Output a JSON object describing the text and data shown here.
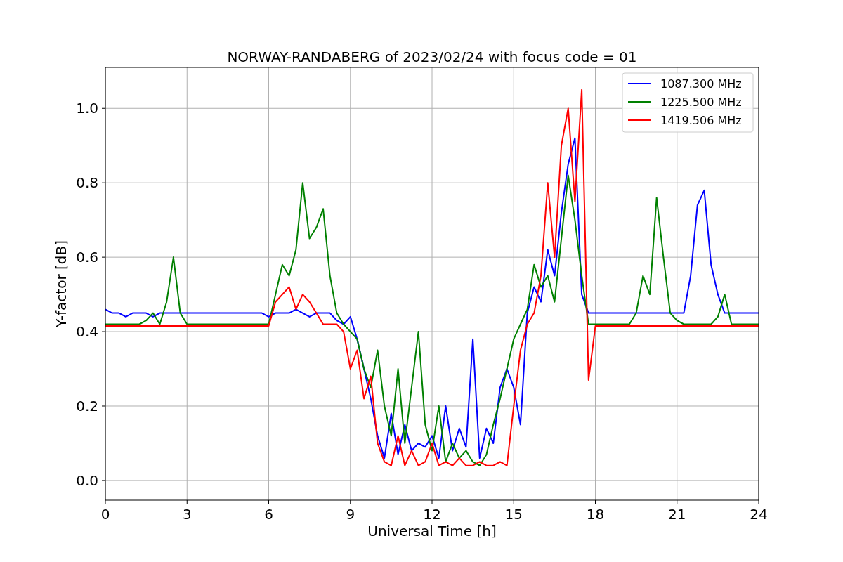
{
  "chart_data": {
    "type": "line",
    "title": "NORWAY-RANDABERG of 2023/02/24 with focus code = 01",
    "xlabel": "Universal Time [h]",
    "ylabel": "Y-factor [dB]",
    "x": [
      0,
      0.25,
      0.5,
      0.75,
      1,
      1.25,
      1.5,
      1.75,
      2,
      2.25,
      2.5,
      2.75,
      3,
      3.25,
      3.5,
      3.75,
      4,
      4.25,
      4.5,
      4.75,
      5,
      5.25,
      5.5,
      5.75,
      6,
      6.25,
      6.5,
      6.75,
      7,
      7.25,
      7.5,
      7.75,
      8,
      8.25,
      8.5,
      8.75,
      9,
      9.25,
      9.5,
      9.75,
      10,
      10.25,
      10.5,
      10.75,
      11,
      11.25,
      11.5,
      11.75,
      12,
      12.25,
      12.5,
      12.75,
      13,
      13.25,
      13.5,
      13.75,
      14,
      14.25,
      14.5,
      14.75,
      15,
      15.25,
      15.5,
      15.75,
      16,
      16.25,
      16.5,
      16.75,
      17,
      17.25,
      17.5,
      17.75,
      18,
      18.25,
      18.5,
      18.75,
      19,
      19.25,
      19.5,
      19.75,
      20,
      20.25,
      20.5,
      20.75,
      21,
      21.25,
      21.5,
      21.75,
      22,
      22.25,
      22.5,
      22.75,
      23,
      23.25,
      23.5,
      23.75,
      24
    ],
    "series": [
      {
        "name": "1087.300 MHz",
        "color": "#0000ff",
        "values": [
          0.46,
          0.45,
          0.45,
          0.44,
          0.45,
          0.45,
          0.45,
          0.44,
          0.45,
          0.45,
          0.45,
          0.45,
          0.45,
          0.45,
          0.45,
          0.45,
          0.45,
          0.45,
          0.45,
          0.45,
          0.45,
          0.45,
          0.45,
          0.45,
          0.44,
          0.45,
          0.45,
          0.45,
          0.46,
          0.45,
          0.44,
          0.45,
          0.45,
          0.45,
          0.43,
          0.42,
          0.44,
          0.38,
          0.3,
          0.22,
          0.12,
          0.06,
          0.18,
          0.07,
          0.15,
          0.08,
          0.1,
          0.09,
          0.12,
          0.06,
          0.2,
          0.08,
          0.14,
          0.09,
          0.38,
          0.06,
          0.14,
          0.1,
          0.25,
          0.3,
          0.25,
          0.15,
          0.45,
          0.52,
          0.48,
          0.62,
          0.55,
          0.72,
          0.85,
          0.92,
          0.5,
          0.45,
          0.45,
          0.45,
          0.45,
          0.45,
          0.45,
          0.45,
          0.45,
          0.45,
          0.45,
          0.45,
          0.45,
          0.45,
          0.45,
          0.45,
          0.55,
          0.74,
          0.78,
          0.58,
          0.5,
          0.45,
          0.45,
          0.45,
          0.45,
          0.45,
          0.45
        ]
      },
      {
        "name": "1225.500 MHz",
        "color": "#008000",
        "values": [
          0.42,
          0.42,
          0.42,
          0.42,
          0.42,
          0.42,
          0.43,
          0.45,
          0.42,
          0.48,
          0.6,
          0.45,
          0.42,
          0.42,
          0.42,
          0.42,
          0.42,
          0.42,
          0.42,
          0.42,
          0.42,
          0.42,
          0.42,
          0.42,
          0.42,
          0.5,
          0.58,
          0.55,
          0.62,
          0.8,
          0.65,
          0.68,
          0.73,
          0.55,
          0.45,
          0.42,
          0.4,
          0.38,
          0.3,
          0.25,
          0.35,
          0.2,
          0.12,
          0.3,
          0.1,
          0.25,
          0.4,
          0.15,
          0.08,
          0.2,
          0.05,
          0.1,
          0.06,
          0.08,
          0.05,
          0.04,
          0.07,
          0.15,
          0.22,
          0.3,
          0.38,
          0.42,
          0.46,
          0.58,
          0.52,
          0.55,
          0.48,
          0.65,
          0.82,
          0.7,
          0.55,
          0.42,
          0.42,
          0.42,
          0.42,
          0.42,
          0.42,
          0.42,
          0.45,
          0.55,
          0.5,
          0.76,
          0.6,
          0.45,
          0.43,
          0.42,
          0.42,
          0.42,
          0.42,
          0.42,
          0.44,
          0.5,
          0.42,
          0.42,
          0.42,
          0.42,
          0.42
        ]
      },
      {
        "name": "1419.506 MHz",
        "color": "#ff0000",
        "values": [
          0.415,
          0.415,
          0.415,
          0.415,
          0.415,
          0.415,
          0.415,
          0.415,
          0.415,
          0.415,
          0.415,
          0.415,
          0.415,
          0.415,
          0.415,
          0.415,
          0.415,
          0.415,
          0.415,
          0.415,
          0.415,
          0.415,
          0.415,
          0.415,
          0.415,
          0.48,
          0.5,
          0.52,
          0.46,
          0.5,
          0.48,
          0.45,
          0.42,
          0.42,
          0.42,
          0.4,
          0.3,
          0.35,
          0.22,
          0.28,
          0.1,
          0.05,
          0.04,
          0.12,
          0.04,
          0.08,
          0.04,
          0.05,
          0.1,
          0.04,
          0.05,
          0.04,
          0.06,
          0.04,
          0.04,
          0.05,
          0.04,
          0.04,
          0.05,
          0.04,
          0.2,
          0.35,
          0.42,
          0.45,
          0.55,
          0.8,
          0.6,
          0.9,
          1.0,
          0.75,
          1.05,
          0.27,
          0.415,
          0.415,
          0.415,
          0.415,
          0.415,
          0.415,
          0.415,
          0.415,
          0.415,
          0.415,
          0.415,
          0.415,
          0.415,
          0.415,
          0.415,
          0.415,
          0.415,
          0.415,
          0.415,
          0.415,
          0.415,
          0.415,
          0.415,
          0.415,
          0.415
        ]
      }
    ],
    "grid": true,
    "legend": true,
    "xlim": [
      0,
      24
    ],
    "ylim": [
      -0.053,
      1.11
    ],
    "xticks": [
      0,
      3,
      6,
      9,
      12,
      15,
      18,
      21,
      24
    ],
    "yticks": [
      {
        "value": 0,
        "label": "0.0"
      },
      {
        "value": 0.2,
        "label": "0.2"
      },
      {
        "value": 0.4,
        "label": "0.4"
      },
      {
        "value": 0.6,
        "label": "0.6"
      },
      {
        "value": 0.8,
        "label": "0.8"
      },
      {
        "value": 1,
        "label": "1.0"
      }
    ]
  }
}
